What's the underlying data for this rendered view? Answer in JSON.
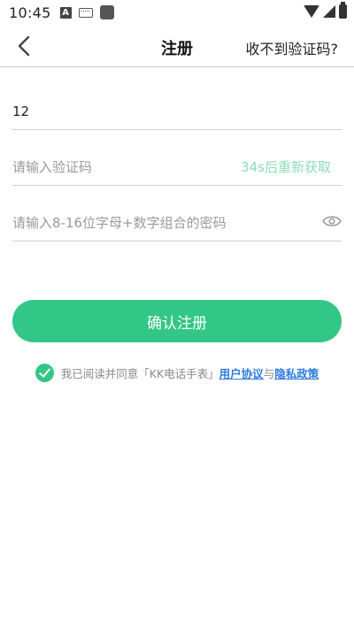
{
  "status_bar": {
    "time": "10:45",
    "icons": [
      "a-notification-icon",
      "keyboard-icon",
      "app-square-icon",
      "wifi-icon",
      "signal-icon",
      "battery-charging-icon"
    ]
  },
  "nav": {
    "back_icon": "chevron-left-icon",
    "title": "注册",
    "action_label": "收不到验证码?"
  },
  "form": {
    "phone_value": "12",
    "code_placeholder": "请输入验证码",
    "resend_label": "34s后重新获取",
    "password_placeholder": "请输入8-16位字母+数字组合的密码",
    "eye_icon": "eye-icon",
    "submit_label": "确认注册"
  },
  "agreement": {
    "text_prefix": "我已阅读并同意「KK电话手表」",
    "user_agreement": "用户协议",
    "conjunction": "与",
    "privacy_policy": "隐私政策",
    "checked": true
  },
  "colors": {
    "accent": "#33c787",
    "resend_disabled": "#8fdcb9",
    "link": "#2d7be0"
  }
}
